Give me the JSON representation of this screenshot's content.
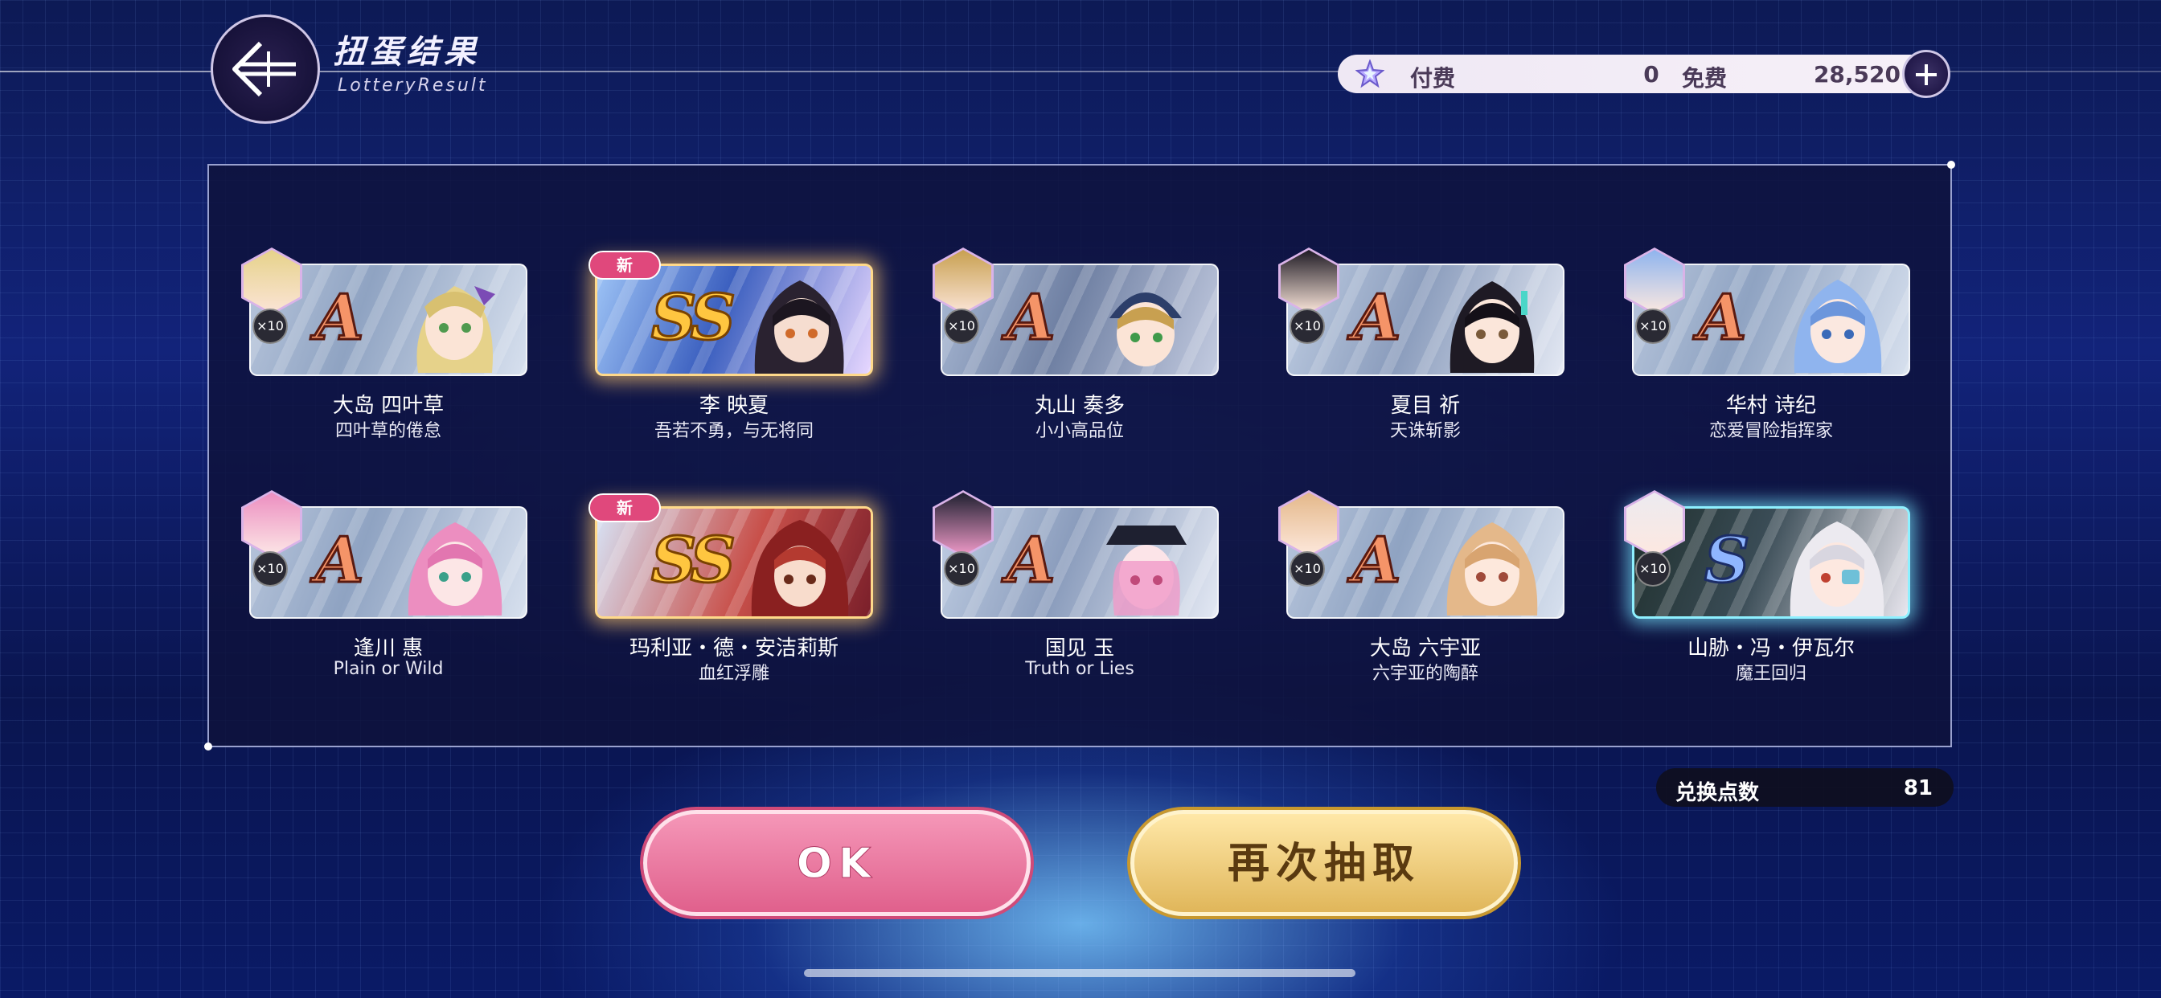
{
  "header": {
    "title_zh": "扭蛋结果",
    "title_en": "LotteryResult"
  },
  "currency": {
    "paid_label": "付费",
    "paid_value": "0",
    "free_label": "免费",
    "free_value": "28,520"
  },
  "results": [
    {
      "rank": "A",
      "count": "×10",
      "new": false,
      "name": "大岛 四叶草",
      "subtitle": "四叶草的倦怠"
    },
    {
      "rank": "SS",
      "count": "",
      "new": true,
      "name": "李 映夏",
      "subtitle": "吾若不勇，与无将同"
    },
    {
      "rank": "A",
      "count": "×10",
      "new": false,
      "name": "丸山 奏多",
      "subtitle": "小小高品位"
    },
    {
      "rank": "A",
      "count": "×10",
      "new": false,
      "name": "夏目 祈",
      "subtitle": "天诛斩影"
    },
    {
      "rank": "A",
      "count": "×10",
      "new": false,
      "name": "华村 诗纪",
      "subtitle": "恋爱冒险指挥家"
    },
    {
      "rank": "A",
      "count": "×10",
      "new": false,
      "name": "逢川 惠",
      "subtitle": "Plain or Wild"
    },
    {
      "rank": "SS",
      "count": "",
      "new": true,
      "name": "玛利亚・德・安洁莉斯",
      "subtitle": "血红浮雕"
    },
    {
      "rank": "A",
      "count": "×10",
      "new": false,
      "name": "国见 玉",
      "subtitle": "Truth or Lies"
    },
    {
      "rank": "A",
      "count": "×10",
      "new": false,
      "name": "大岛 六宇亚",
      "subtitle": "六宇亚的陶醉"
    },
    {
      "rank": "S",
      "count": "×10",
      "new": false,
      "name": "山胁・冯・伊瓦尔",
      "subtitle": "魔王回归"
    }
  ],
  "new_label": "新",
  "exchange": {
    "label": "兑换点数",
    "value": "81"
  },
  "buttons": {
    "ok": "OK",
    "again": "再次抽取"
  },
  "colors": {
    "rank_a": "#f59468",
    "rank_ss": "#ffc640",
    "rank_s": "#8fb6ff",
    "ok_button": "#e0608c",
    "again_button": "#e0b65a",
    "new_tag": "#e0487c"
  }
}
